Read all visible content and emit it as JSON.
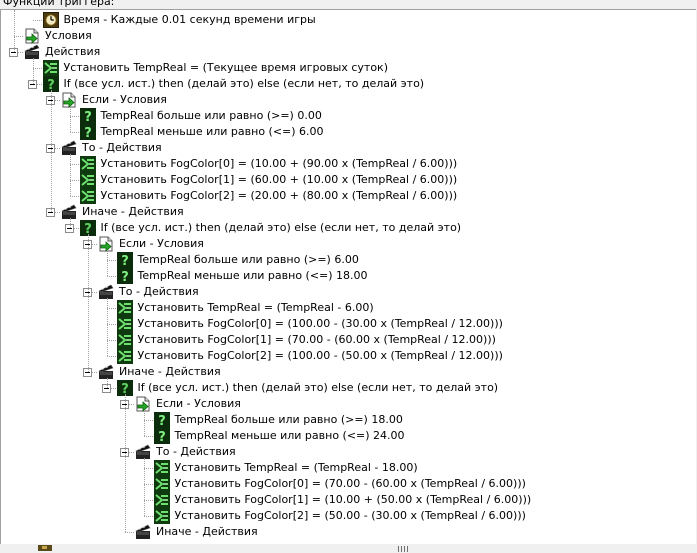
{
  "header_fragment": "Функции триггера:",
  "tree": [
    {
      "label": "Время - Каждые 0.01 секунд времени игры",
      "icon": "timer-event-icon",
      "depth": 2,
      "expander": false
    },
    {
      "label": "Условия",
      "icon": "conditions-icon",
      "depth": 1,
      "expander": false
    },
    {
      "label": "Действия",
      "icon": "actions-icon",
      "depth": 1,
      "expander": true
    },
    {
      "label": "Установить TempReal = (Текущее время игровых суток)",
      "icon": "set-variable-icon",
      "depth": 2,
      "expander": false
    },
    {
      "label": "If (все усл. ист.) then (делай это) else (если нет, то делай это)",
      "icon": "if-then-else-icon",
      "depth": 2,
      "expander": true
    },
    {
      "label": "Если - Условия",
      "icon": "conditions-icon",
      "depth": 3,
      "expander": true
    },
    {
      "label": "TempReal больше или равно (>=) 0.00",
      "icon": "condition-icon",
      "depth": 4,
      "expander": false
    },
    {
      "label": "TempReal меньше или равно (<=) 6.00",
      "icon": "condition-icon",
      "depth": 4,
      "expander": false
    },
    {
      "label": "То - Действия",
      "icon": "actions-icon",
      "depth": 3,
      "expander": true
    },
    {
      "label": "Установить FogColor[0] = (10.00 + (90.00 x (TempReal / 6.00)))",
      "icon": "set-variable-icon",
      "depth": 4,
      "expander": false
    },
    {
      "label": "Установить FogColor[1] = (60.00 + (10.00 x (TempReal / 6.00)))",
      "icon": "set-variable-icon",
      "depth": 4,
      "expander": false
    },
    {
      "label": "Установить FogColor[2] = (20.00 + (80.00 x (TempReal / 6.00)))",
      "icon": "set-variable-icon",
      "depth": 4,
      "expander": false
    },
    {
      "label": "Иначе - Действия",
      "icon": "actions-icon",
      "depth": 3,
      "expander": true
    },
    {
      "label": "If (все усл. ист.) then (делай это) else (если нет, то делай это)",
      "icon": "if-then-else-icon",
      "depth": 4,
      "expander": true
    },
    {
      "label": "Если - Условия",
      "icon": "conditions-icon",
      "depth": 5,
      "expander": true
    },
    {
      "label": "TempReal больше или равно (>=) 6.00",
      "icon": "condition-icon",
      "depth": 6,
      "expander": false
    },
    {
      "label": "TempReal меньше или равно (<=) 18.00",
      "icon": "condition-icon",
      "depth": 6,
      "expander": false
    },
    {
      "label": "То - Действия",
      "icon": "actions-icon",
      "depth": 5,
      "expander": true
    },
    {
      "label": "Установить TempReal = (TempReal - 6.00)",
      "icon": "set-variable-icon",
      "depth": 6,
      "expander": false
    },
    {
      "label": "Установить FogColor[0] = (100.00 - (30.00 x (TempReal / 12.00)))",
      "icon": "set-variable-icon",
      "depth": 6,
      "expander": false
    },
    {
      "label": "Установить FogColor[1] = (70.00 - (60.00 x (TempReal / 12.00)))",
      "icon": "set-variable-icon",
      "depth": 6,
      "expander": false
    },
    {
      "label": "Установить FogColor[2] = (100.00 - (50.00 x (TempReal / 12.00)))",
      "icon": "set-variable-icon",
      "depth": 6,
      "expander": false
    },
    {
      "label": "Иначе - Действия",
      "icon": "actions-icon",
      "depth": 5,
      "expander": true
    },
    {
      "label": "If (все усл. ист.) then (делай это) else (если нет, то делай это)",
      "icon": "if-then-else-icon",
      "depth": 6,
      "expander": true
    },
    {
      "label": "Если - Условия",
      "icon": "conditions-icon",
      "depth": 7,
      "expander": true
    },
    {
      "label": "TempReal больше или равно (>=) 18.00",
      "icon": "condition-icon",
      "depth": 8,
      "expander": false
    },
    {
      "label": "TempReal меньше или равно (<=) 24.00",
      "icon": "condition-icon",
      "depth": 8,
      "expander": false
    },
    {
      "label": "То - Действия",
      "icon": "actions-icon",
      "depth": 7,
      "expander": true
    },
    {
      "label": "Установить TempReal = (TempReal - 18.00)",
      "icon": "set-variable-icon",
      "depth": 8,
      "expander": false
    },
    {
      "label": "Установить FogColor[0] = (70.00 - (60.00 x (TempReal / 6.00)))",
      "icon": "set-variable-icon",
      "depth": 8,
      "expander": false
    },
    {
      "label": "Установить FogColor[1] = (10.00 + (50.00 x (TempReal / 6.00)))",
      "icon": "set-variable-icon",
      "depth": 8,
      "expander": false
    },
    {
      "label": "Установить FogColor[2] = (50.00 - (30.00 x (TempReal / 6.00)))",
      "icon": "set-variable-icon",
      "depth": 8,
      "expander": false
    },
    {
      "label": "Иначе - Действия",
      "icon": "actions-icon",
      "depth": 7,
      "expander": false
    }
  ],
  "colors": {
    "tree_background": "#ffffff",
    "condition_green": "#2e8b2e",
    "condition_dark": "#0c2d0c",
    "action_green": "#3a9a3a",
    "frame_gray": "#f0f0f0"
  }
}
